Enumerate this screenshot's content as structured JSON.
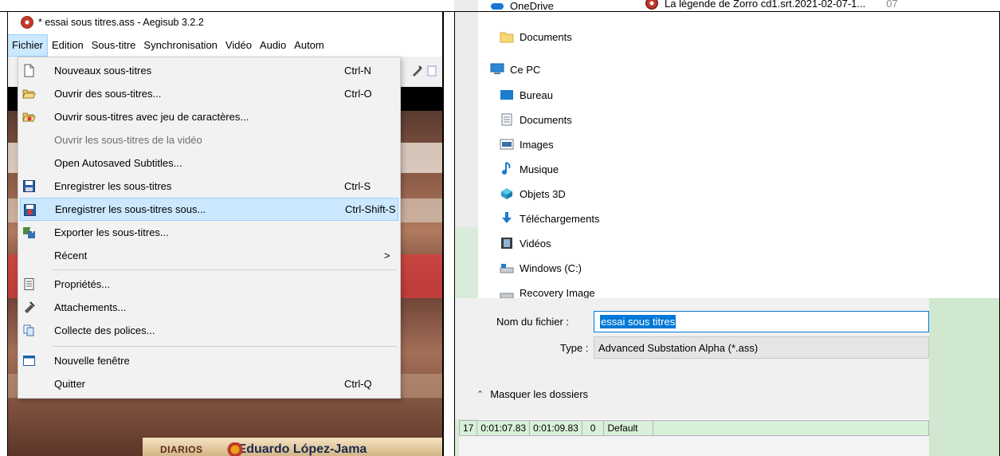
{
  "aegisub": {
    "window_title": "* essai sous titres.ass - Aegisub 3.2.2",
    "menubar": [
      {
        "label": "Fichier",
        "active": true
      },
      {
        "label": "Edition"
      },
      {
        "label": "Sous-titre"
      },
      {
        "label": "Synchronisation"
      },
      {
        "label": "Vidéo"
      },
      {
        "label": "Audio"
      },
      {
        "label": "Autom"
      }
    ],
    "file_menu": {
      "items": [
        {
          "label": "Nouveaux sous-titres",
          "shortcut": "Ctrl-N",
          "icon": "new-document-icon"
        },
        {
          "label": "Ouvrir des sous-titres...",
          "shortcut": "Ctrl-O",
          "icon": "open-folder-icon"
        },
        {
          "label": "Ouvrir sous-titres avec jeu de caractères...",
          "shortcut": "",
          "icon": "open-charset-icon"
        },
        {
          "label": "Ouvrir les sous-titres de la vidéo",
          "shortcut": "",
          "disabled": true
        },
        {
          "label": "Open Autosaved Subtitles...",
          "shortcut": ""
        },
        {
          "label": "Enregistrer les sous-titres",
          "shortcut": "Ctrl-S",
          "icon": "save-icon"
        },
        {
          "label": "Enregistrer les sous-titres sous...",
          "shortcut": "Ctrl-Shift-S",
          "icon": "save-as-icon",
          "highlighted": true
        },
        {
          "label": "Exporter les sous-titres...",
          "shortcut": "",
          "icon": "export-icon"
        },
        {
          "label": "Récent",
          "shortcut": "",
          "submenu_arrow": ">"
        },
        {
          "label": "Propriétés...",
          "shortcut": "",
          "icon": "properties-icon"
        },
        {
          "label": "Attachements...",
          "shortcut": "",
          "icon": "attachment-icon"
        },
        {
          "label": "Collecte des polices...",
          "shortcut": "",
          "icon": "fonts-collector-icon"
        },
        {
          "label": "Nouvelle fenêtre",
          "shortcut": "",
          "icon": "new-window-icon"
        },
        {
          "label": "Quitter",
          "shortcut": "Ctrl-Q"
        }
      ]
    },
    "video_banner": {
      "brand": "DIARIOS",
      "name": "Eduardo López-Jama"
    }
  },
  "save_dialog": {
    "nav_items": [
      {
        "label": "OneDrive",
        "icon": "cloud-icon"
      },
      {
        "label": "Documents",
        "icon": "folder-icon"
      },
      {
        "label": "Ce PC",
        "icon": "computer-icon"
      },
      {
        "label": "Bureau",
        "icon": "desktop-icon"
      },
      {
        "label": "Documents",
        "icon": "documents-icon"
      },
      {
        "label": "Images",
        "icon": "images-icon"
      },
      {
        "label": "Musique",
        "icon": "music-icon"
      },
      {
        "label": "Objets 3D",
        "icon": "objects-3d-icon"
      },
      {
        "label": "Téléchargements",
        "icon": "download-icon"
      },
      {
        "label": "Vidéos",
        "icon": "videos-icon"
      },
      {
        "label": "Windows (C:)",
        "icon": "drive-icon"
      },
      {
        "label": "Recovery Image",
        "icon": "drive-icon"
      }
    ],
    "file_row": {
      "name": "La légende de Zorro cd1.srt.2021-02-07-1...",
      "date": "07"
    },
    "filename_label": "Nom du fichier :",
    "filename_value": "essai sous titres",
    "type_label": "Type :",
    "type_value": "Advanced Substation Alpha (*.ass)",
    "hide_folders_label": "Masquer les dossiers"
  },
  "subtitle_grid_row": {
    "number": "17",
    "start": "0:01:07.83",
    "end": "0:01:09.83",
    "layer": "0",
    "style": "Default"
  }
}
